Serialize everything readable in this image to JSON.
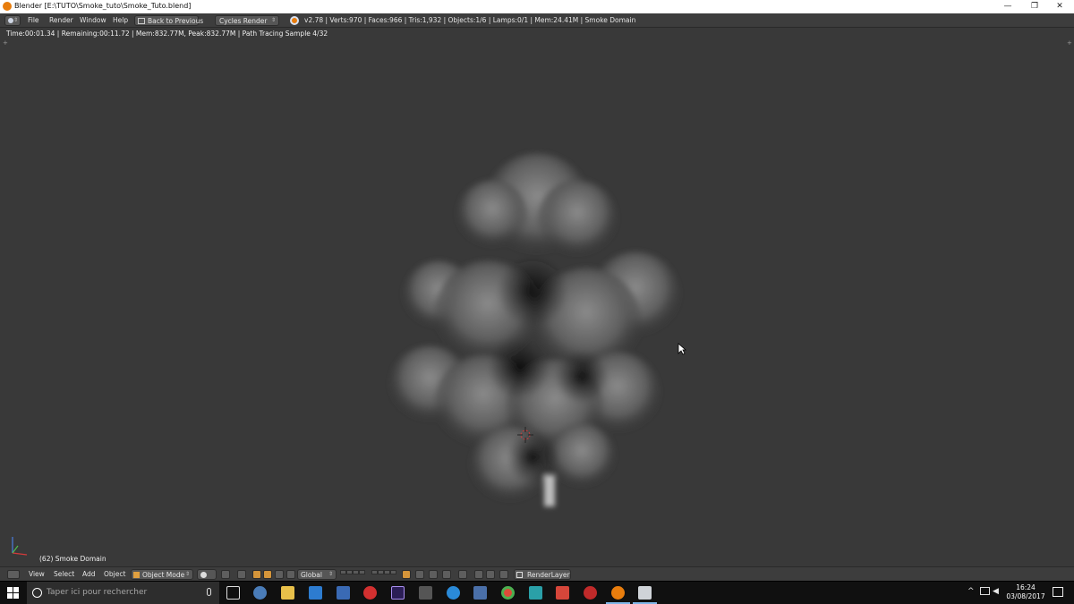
{
  "window": {
    "title": "Blender [E:\\TUTO\\Smoke_tuto\\Smoke_Tuto.blend]",
    "minimize": "—",
    "restore": "❐",
    "close": "✕"
  },
  "info_header": {
    "menus": [
      "File",
      "Render",
      "Window",
      "Help"
    ],
    "back_to_previous": "Back to Previous",
    "render_engine": "Cycles Render",
    "stats": "v2.78 | Verts:970 | Faces:966 | Tris:1,932 | Objects:1/6 | Lamps:0/1 | Mem:24.41M | Smoke Domain"
  },
  "viewport": {
    "render_status": "Time:00:01.34 | Remaining:00:11.72 | Mem:832.77M, Peak:832.77M | Path Tracing Sample 4/32",
    "object_label": "(62) Smoke Domain",
    "corner_plus": "+"
  },
  "view3d_header": {
    "menus": [
      "View",
      "Select",
      "Add",
      "Object"
    ],
    "mode": "Object Mode",
    "orientation": "Global",
    "render_layer": "RenderLayer"
  },
  "taskbar": {
    "search_placeholder": "Taper ici pour rechercher",
    "apps": [
      "task-view-icon",
      "app-icon",
      "file-explorer-icon",
      "mail-icon",
      "app-icon",
      "app-icon",
      "after-effects-icon",
      "app-icon",
      "app-icon",
      "app-icon",
      "chrome-icon",
      "app-icon",
      "app-icon",
      "app-icon",
      "blender-icon",
      "app-icon"
    ],
    "time": "16:24",
    "date": "03/08/2017",
    "tray_chevron": "^"
  },
  "colors": {
    "viewport_bg": "#393939",
    "header_bg": "#3d3d3d",
    "accent_orange": "#e87d0d",
    "taskbar_bg": "#101010"
  }
}
